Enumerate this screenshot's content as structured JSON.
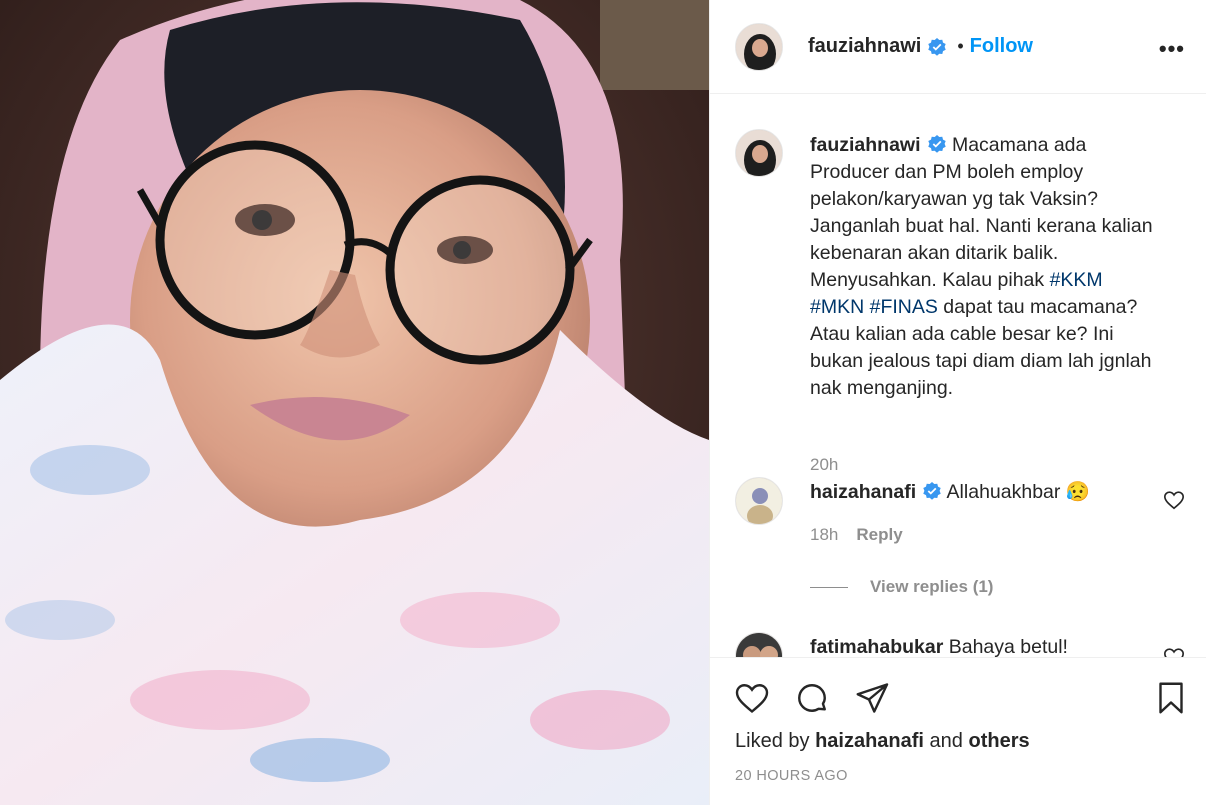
{
  "post": {
    "author": "fauziahnawi",
    "follow_label": "Follow",
    "dot": "•",
    "more": "•••"
  },
  "caption": {
    "username": "fauziahnawi",
    "text_a": "Macamana ada Producer dan PM boleh employ pelakon/karyawan yg tak Vaksin? Janganlah buat hal. Nanti kerana kalian kebenaran akan ditarik balik. Menyusahkan. Kalau pihak ",
    "tag1": "#KKM",
    "tag2": "#MKN",
    "tag3": "#FINAS",
    "text_b": " dapat tau macamana? Atau kalian ada cable besar ke? Ini bukan jealous tapi diam diam lah jgnlah nak menganjing.",
    "time": "20h"
  },
  "comments": [
    {
      "username": "haizahanafi",
      "text": "Allahuakhbar 😥",
      "time": "18h",
      "reply_label": "Reply",
      "view_replies": "View replies (1)"
    },
    {
      "username": "fatimahabukar",
      "text": "Bahaya betul!"
    }
  ],
  "footer": {
    "liked_by": "Liked by",
    "liked_user": "haizahanafi",
    "and": "and",
    "others": "others",
    "timestamp": "20 HOURS AGO"
  },
  "colors": {
    "accent": "#0095f6",
    "verified": "#3897f0",
    "hashtag": "#00376b",
    "muted": "#8e8e8e"
  }
}
